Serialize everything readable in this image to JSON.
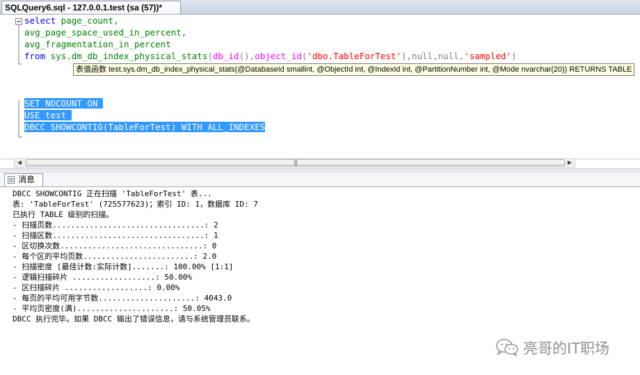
{
  "tab": {
    "title": "SQLQuery6.sql - 127.0.0.1.test (sa (57))*"
  },
  "editor": {
    "line1": {
      "kw": "select",
      "rest": " page_count,"
    },
    "line2": {
      "text": "avg_page_space_used_in_percent,"
    },
    "line3": {
      "text": "avg_fragmentation_in_percent"
    },
    "line4": {
      "kw": "from",
      "sysfunc": "sys.dm_db_index_physical_stats",
      "open": "(",
      "fn1": "db_id",
      "p1": "(),",
      "fn2": "object_id",
      "p2": "(",
      "str1": "'dbo.TableForTest'",
      "p3": "),",
      "nulls": "null,null,",
      "str2": "'sampled'",
      "close": ")"
    },
    "tooltip": "表值函数 test.sys.dm_db_index_physical_stats(@DatabaseId smallint, @ObjectId int, @IndexId int, @PartitionNumber int, @Mode nvarchar(20)) RETURNS TABLE",
    "line5": "SET NOCOUNT ON ",
    "line6": "USE test ",
    "line7": "DBCC SHOWCONTIG(TableForTest) WITH ALL_INDEXES"
  },
  "scrollbar": {
    "left_arrow": "◀",
    "right_arrow": "▶",
    "grip": "|||"
  },
  "results": {
    "tab_label": "消息",
    "lines": [
      "DBCC SHOWCONTIG 正在扫描 'TableForTest' 表...",
      "表: 'TableForTest' (725577623)；索引 ID: 1，数据库 ID: 7",
      "已执行 TABLE 级别的扫描。",
      "- 扫描页数.................................: 2",
      "- 扫描区数.................................: 1",
      "- 区切换次数...............................: 0",
      "- 每个区的平均页数........................: 2.0",
      "- 扫描密度 [最佳计数:实际计数].......: 100.00% [1:1]",
      "- 逻辑扫描碎片 ..................: 50.00%",
      "- 区扫描碎片 ..................: 0.00%",
      "- 每页的平均可用字节数.....................: 4043.0",
      "- 平均页密度(满).....................: 50.05%",
      "DBCC 执行完毕。如果 DBCC 输出了错误信息，请与系统管理员联系。"
    ]
  },
  "watermark": {
    "text": "亮哥的IT职场"
  }
}
